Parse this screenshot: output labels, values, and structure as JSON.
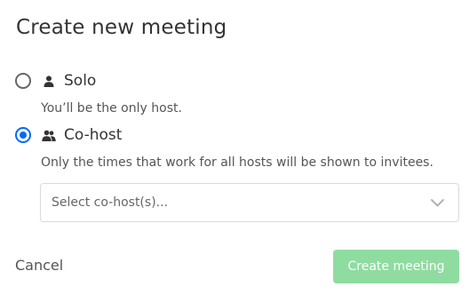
{
  "dialog": {
    "title": "Create new meeting",
    "options": [
      {
        "label": "Solo",
        "description": "You’ll be the only host.",
        "icon": "person-icon",
        "selected": false
      },
      {
        "label": "Co-host",
        "description": "Only the times that work for all hosts will be shown to invitees.",
        "icon": "people-icon",
        "selected": true
      }
    ],
    "cohost_select": {
      "placeholder": "Select co-host(s)...",
      "icon": "chevron-down-icon"
    },
    "actions": {
      "cancel_label": "Cancel",
      "create_label": "Create meeting",
      "create_enabled": false
    }
  },
  "colors": {
    "accent": "#0069ff",
    "primary_disabled": "#8fdca1",
    "text": "#333333",
    "border": "#dadada"
  }
}
